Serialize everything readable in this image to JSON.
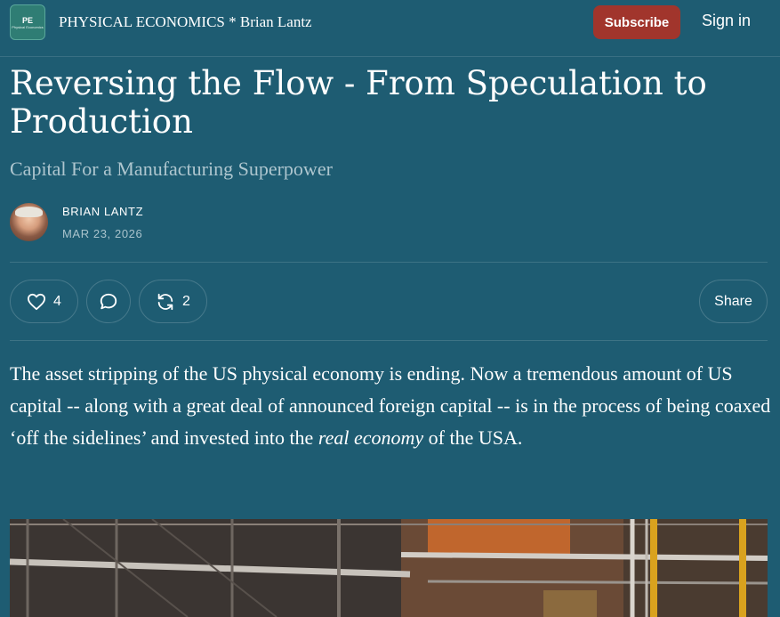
{
  "header": {
    "logo_text": "PE",
    "logo_subtext": "Physical Economics",
    "publication": "PHYSICAL ECONOMICS * Brian Lantz",
    "subscribe_label": "Subscribe",
    "signin_label": "Sign in"
  },
  "article": {
    "title": "Reversing the Flow - From Speculation to Production",
    "subtitle": "Capital For a Manufacturing Superpower",
    "author": "BRIAN LANTZ",
    "date": "MAR 23, 2026"
  },
  "actions": {
    "likes": "4",
    "restacks": "2",
    "share_label": "Share"
  },
  "body": {
    "p1_before": "The asset stripping of the US physical economy is ending. Now a tremendous amount of US capital -- along with a great deal of announced foreign capital -- is in the process of being coaxed ‘off the sidelines’ and invested into the ",
    "p1_emphasis": "real economy",
    "p1_after": " of the USA."
  },
  "colors": {
    "background": "#1e5c72",
    "subscribe": "#a1352c",
    "muted_text": "#aec6cf"
  },
  "icons": [
    "heart-icon",
    "comment-icon",
    "restack-icon"
  ]
}
